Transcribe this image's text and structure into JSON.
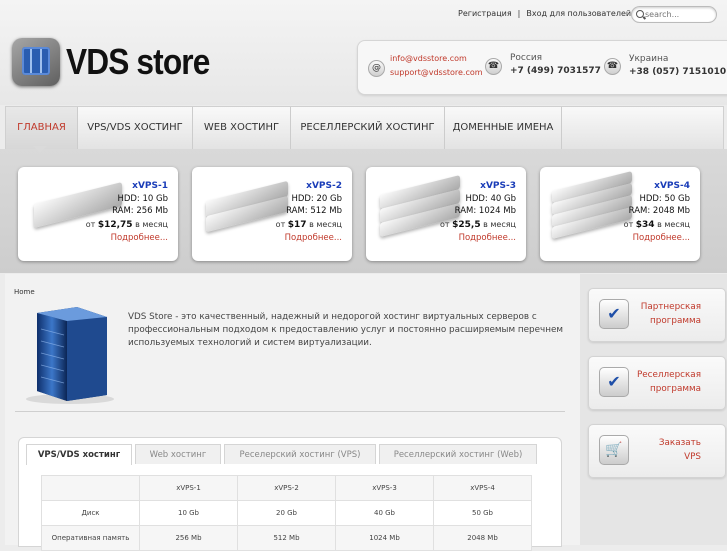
{
  "header": {
    "register": "Регистрация",
    "separator": "|",
    "login": "Вход для пользователей",
    "search_placeholder": "search...",
    "logo_text": "VDS store",
    "email1": "info@vdsstore.com",
    "email2": "support@vdsstore.com",
    "country1": "Россия",
    "phone1": "+7 (499) 7031577",
    "country2": "Украина",
    "phone2": "+38 (057) 7151010"
  },
  "nav": [
    "ГЛАВНАЯ",
    "VPS/VDS ХОСТИНГ",
    "WEB ХОСТИНГ",
    "РЕСЕЛЛЕРСКИЙ ХОСТИНГ",
    "ДОМЕННЫЕ ИМЕНА"
  ],
  "plans": [
    {
      "name": "xVPS-1",
      "hdd": "HDD: 10 Gb",
      "ram": "RAM: 256 Mb",
      "price_prefix": "от",
      "price": "$12,75",
      "price_suffix": "в месяц",
      "more": "Подробнее..."
    },
    {
      "name": "xVPS-2",
      "hdd": "HDD: 20 Gb",
      "ram": "RAM: 512 Mb",
      "price_prefix": "от",
      "price": "$17",
      "price_suffix": "в месяц",
      "more": "Подробнее..."
    },
    {
      "name": "xVPS-3",
      "hdd": "HDD: 40 Gb",
      "ram": "RAM: 1024 Mb",
      "price_prefix": "от",
      "price": "$25,5",
      "price_suffix": "в месяц",
      "more": "Подробнее..."
    },
    {
      "name": "xVPS-4",
      "hdd": "HDD: 50 Gb",
      "ram": "RAM: 2048 Mb",
      "price_prefix": "от",
      "price": "$34",
      "price_suffix": "в месяц",
      "more": "Подробнее..."
    }
  ],
  "main": {
    "breadcrumb": "Home",
    "description": "VDS Store - это качественный, надежный и недорогой хостинг виртуальных серверов с профессиональным подходом к предоставлению услуг и постоянно расширяемым перечнем используемых технологий и систем виртуализации."
  },
  "tabs": [
    "VPS/VDS хостинг",
    "Web хостинг",
    "Реселерский хостинг (VPS)",
    "Реселлерский хостинг (Web)"
  ],
  "table": {
    "header": [
      "",
      "xVPS-1",
      "xVPS-2",
      "xVPS-3",
      "xVPS-4"
    ],
    "rows": [
      [
        "Диск",
        "10 Gb",
        "20 Gb",
        "40 Gb",
        "50 Gb"
      ],
      [
        "Оперативная память",
        "256 Mb",
        "512 Mb",
        "1024 Mb",
        "2048 Mb"
      ]
    ]
  },
  "sidebar": [
    {
      "line1": "Партнерская",
      "line2": "программа",
      "icon": "checkmark-icon"
    },
    {
      "line1": "Реселлерская",
      "line2": "программа",
      "icon": "checkmark-icon"
    },
    {
      "line1": "Заказать",
      "line2": "VPS",
      "icon": "cart-icon"
    }
  ],
  "colors": {
    "accent": "#c0392b",
    "plan_name": "#1a3db8"
  }
}
